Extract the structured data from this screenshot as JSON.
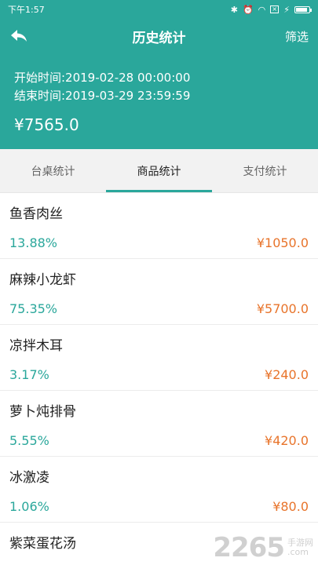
{
  "status_bar": {
    "time": "下午1:57",
    "icons": [
      "bluetooth-icon",
      "alarm-icon",
      "wifi-icon",
      "sim-x-icon",
      "charging-icon",
      "battery-icon"
    ]
  },
  "nav": {
    "title": "历史统计",
    "filter_label": "筛选",
    "back_icon": "back-arrow-icon"
  },
  "summary": {
    "start_time": "开始时间:2019-02-28 00:00:00",
    "end_time": "结束时间:2019-03-29 23:59:59",
    "total": "¥7565.0"
  },
  "tabs": [
    {
      "label": "台桌统计",
      "active": false
    },
    {
      "label": "商品统计",
      "active": true
    },
    {
      "label": "支付统计",
      "active": false
    }
  ],
  "items": [
    {
      "name": "鱼香肉丝",
      "percent": "13.88%",
      "amount": "¥1050.0"
    },
    {
      "name": "麻辣小龙虾",
      "percent": "75.35%",
      "amount": "¥5700.0"
    },
    {
      "name": "凉拌木耳",
      "percent": "3.17%",
      "amount": "¥240.0"
    },
    {
      "name": "萝卜炖排骨",
      "percent": "5.55%",
      "amount": "¥420.0"
    },
    {
      "name": "冰激凌",
      "percent": "1.06%",
      "amount": "¥80.0"
    },
    {
      "name": "紫菜蛋花汤",
      "percent": "",
      "amount": ""
    }
  ],
  "watermark": {
    "number": "2265",
    "suffix": ".com",
    "cn": "手游网"
  },
  "colors": {
    "primary": "#2aa79b",
    "amount": "#e8742b"
  }
}
